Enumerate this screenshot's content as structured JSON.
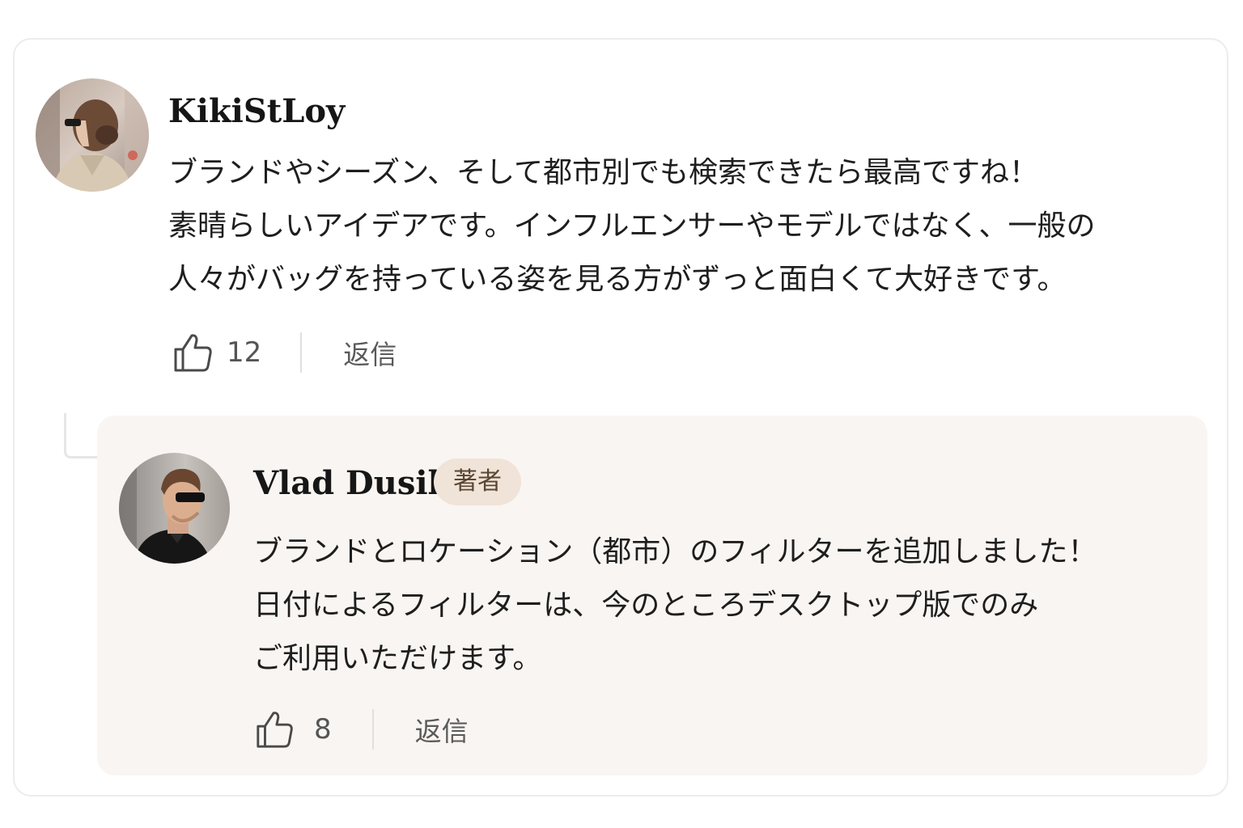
{
  "comment": {
    "author": "KikiStLoy",
    "avatar_alt": "woman-with-sunglasses-avatar",
    "lines": [
      "ブランドやシーズン、そして都市別でも検索できたら最高ですね！",
      "素晴らしいアイデアです。インフルエンサーやモデルではなく、一般の",
      "人々がバッグを持っている姿を見る方がずっと面白くて大好きです。"
    ],
    "likes": "12",
    "reply_label": "返信"
  },
  "reply": {
    "author": "Vlad Dusil",
    "badge": "著者",
    "avatar_alt": "man-with-sunglasses-avatar",
    "lines": [
      "ブランドとロケーション（都市）のフィルターを追加しました！",
      "日付によるフィルターは、今のところデスクトップ版でのみ",
      "ご利用いただけます。"
    ],
    "likes": "8",
    "reply_label": "返信"
  },
  "colors": {
    "reply_background": "#f9f5f2",
    "badge_background": "#f0e4d8",
    "badge_text": "#5a4634",
    "icon": "#4a4a4a"
  },
  "icons": {
    "like": "thumbs-up-icon"
  }
}
